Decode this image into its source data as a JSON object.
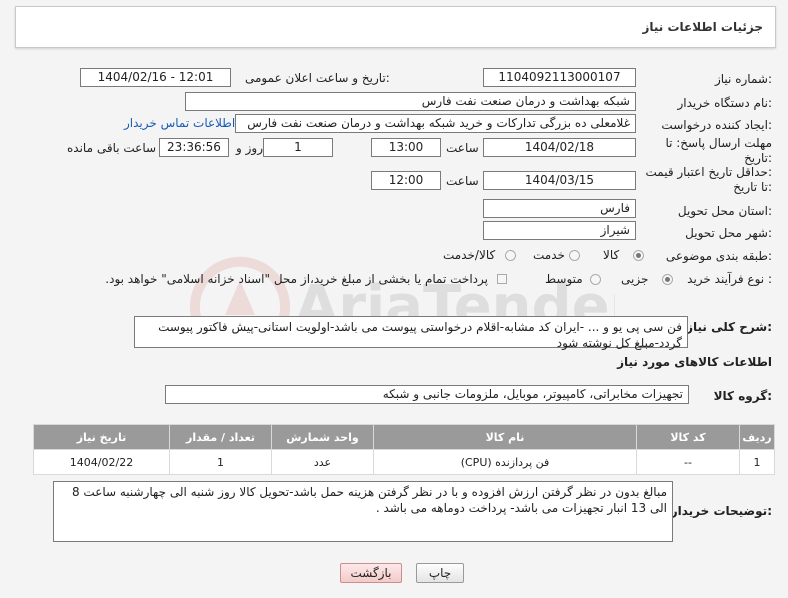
{
  "header": {
    "title": "جزئیات اطلاعات نیاز"
  },
  "fields": {
    "need_number_label": "شماره نیاز:",
    "need_number": "1104092113000107",
    "announce_label": "تاریخ و ساعت اعلان عمومی:",
    "announce_value": "1404/02/16 - 12:01",
    "buyer_org_label": "نام دستگاه خریدار:",
    "buyer_org": "شبکه بهداشت و درمان صنعت نفت فارس",
    "requester_label": "ایجاد کننده درخواست:",
    "requester": "غلامعلی ده بزرگی تدارکات و خرید شبکه بهداشت و درمان صنعت نفت فارس",
    "contact_link": "اطلاعات تماس خریدار",
    "deadline_label_1": "مهلت ارسال پاسخ: تا",
    "deadline_label_2": "تاریخ:",
    "deadline_date": "1404/02/18",
    "time_label": "ساعت",
    "deadline_time": "13:00",
    "days_value": "1",
    "days_label": "روز و",
    "remaining_value": "23:36:56",
    "remaining_label": "ساعت باقی مانده",
    "validity_label_1": "حداقل تاریخ اعتبار قیمت:",
    "validity_label_2": "تا تاریخ:",
    "validity_date": "1404/03/15",
    "validity_time": "12:00",
    "province_label": "استان محل تحویل:",
    "province": "فارس",
    "city_label": "شهر محل تحویل:",
    "city": "شیراز",
    "category_label": "طبقه بندی موضوعی:",
    "category_options": [
      "کالا",
      "خدمت",
      "کالا/خدمت"
    ],
    "category_selected": "کالا",
    "process_label": "نوع فرآیند خرید :",
    "process_options": [
      "جزیی",
      "متوسط"
    ],
    "process_selected": "جزیی",
    "payment_note": "پرداخت تمام یا بخشی از مبلغ خرید،از محل \"اسناد خزانه اسلامی\" خواهد بود."
  },
  "summary": {
    "label": "شرح کلی نیاز:",
    "text": "فن سی پی یو و ... -ایران کد مشابه-اقلام درخواستی پیوست می باشد-اولویت استانی-پیش فاکتور پیوست گردد-مبلغ کل نوشته شود"
  },
  "goods_section": {
    "title": "اطلاعات کالاهای مورد نیاز",
    "group_label": "گروه کالا:",
    "group_value": "تجهیزات مخابراتی، کامپیوتر، موبایل، ملزومات جانبی و شبکه"
  },
  "table": {
    "headers": [
      "ردیف",
      "کد کالا",
      "نام کالا",
      "واحد شمارش",
      "تعداد / مقدار",
      "تاریخ نیاز"
    ],
    "rows": [
      [
        "1",
        "--",
        "فن پردازنده (CPU)",
        "عدد",
        "1",
        "1404/02/22"
      ]
    ]
  },
  "buyer_notes": {
    "label": "توضیحات خریدار:",
    "text": "مبالغ بدون در نظر گرفتن ارزش افزوده و با در نظر گرفتن هزینه حمل باشد-تحویل کالا روز شنبه الی چهارشنبه ساعت 8 الی 13 انبار تجهیزات می باشد- پرداخت دوماهه می باشد ."
  },
  "buttons": {
    "print": "چاپ",
    "back": "بازگشت"
  },
  "watermark": {
    "text": "AriaTender.neT"
  },
  "colors": {
    "link": "#1a5bb5",
    "table_header": "#9a9a9a",
    "back_button": "#f3caca"
  }
}
